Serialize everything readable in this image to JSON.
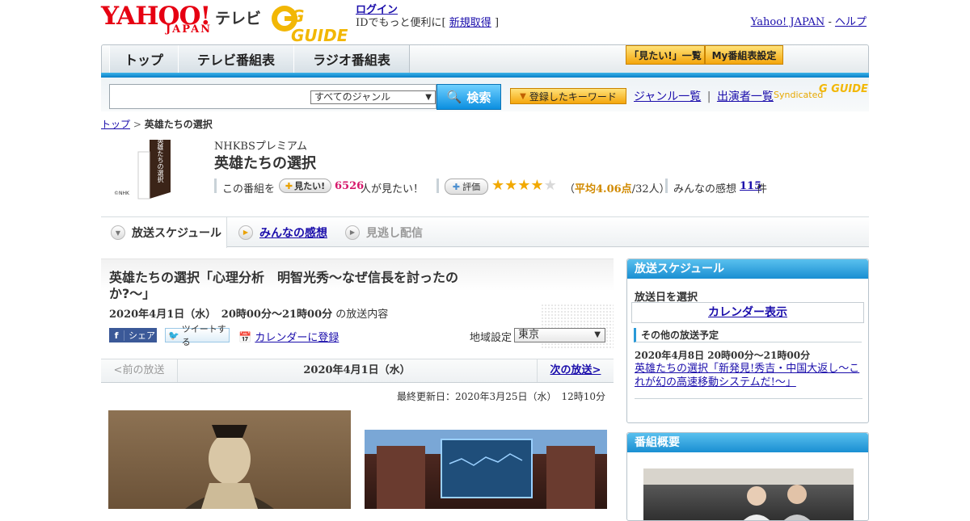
{
  "header": {
    "logo_main": "YAHOO!",
    "logo_sub": "JAPAN",
    "tv_label": "テレビ",
    "gguide_logo": "G GUIDE",
    "login_link": "ログイン",
    "login_prefix": "IDでもっと便利に[",
    "register_link": "新規取得",
    "login_suffix": "]",
    "yahoo_japan_link": "Yahoo! JAPAN",
    "help_sep": "-",
    "help_link": "ヘルプ"
  },
  "nav": {
    "tabs": [
      "トップ",
      "テレビ番組表",
      "ラジオ番組表"
    ],
    "mitai_list_button": "「見たい!」一覧",
    "my_schedule_button": "My番組表設定"
  },
  "search": {
    "input_value": "",
    "genre_selected": "すべてのジャンル",
    "search_button": "検索",
    "keyword_button": "登録したキーワード",
    "genre_list_link": "ジャンル一覧",
    "sep": "|",
    "performer_list_link": "出演者一覧",
    "syndicated_label": "Syndicated",
    "gguide_small": "G GUIDE"
  },
  "breadcrumb": {
    "top_link": "トップ",
    "sep": ">",
    "current": "英雄たちの選択"
  },
  "program": {
    "channel": "NHKBSプレミアム",
    "title": "英雄たちの選択",
    "logo_text": "英雄たちの選択",
    "logo_nhk": "©NHK",
    "mitai_prefix": "この番組を",
    "mitai_button": "見たい!",
    "mitai_count": "6526",
    "mitai_suffix": "人が見たい！",
    "rate_button": "評価",
    "rating_stars": 4,
    "rating_open": "（",
    "rating_avg_label": "平均4.06点",
    "rating_count": "/32人）",
    "reviews_prefix": "みんなの感想",
    "reviews_count": "115",
    "reviews_suffix": "件"
  },
  "tabs": {
    "schedule": "放送スケジュール",
    "reviews": "みんなの感想",
    "missed": "見逃し配信"
  },
  "episode": {
    "title": "英雄たちの選択「心理分析　明智光秀～なぜ信長を討ったのか?～」",
    "datetime": "2020年4月1日（水）　20時00分～21時00分",
    "datetime_suffix": "の放送内容",
    "share_button": "シェア",
    "tweet_button": "ツイートする",
    "calendar_link": "カレンダーに登録",
    "region_label": "地域設定",
    "region_selected": "東京",
    "prev_label": "<前の放送",
    "date_center": "2020年4月1日（水）",
    "next_label": "次の放送>",
    "updated": "最終更新日：2020年3月25日（水）　12時10分"
  },
  "sidebar": {
    "schedule_header": "放送スケジュール",
    "select_date_label": "放送日を選択",
    "calendar_link": "カレンダー表示",
    "other_header": "その他の放送予定",
    "other_datetime": "2020年4月8日  20時00分～21時00分",
    "other_link": "英雄たちの選択「新発見!秀吉・中国大返し～これが幻の高速移動システムだ!～」",
    "summary_header": "番組概要"
  },
  "colors": {
    "link": "#1a0dab",
    "accent_blue": "#1a8fd2",
    "brand_red": "#e60012",
    "pink_count": "#d6186b",
    "rating_orange": "#d18a00"
  }
}
